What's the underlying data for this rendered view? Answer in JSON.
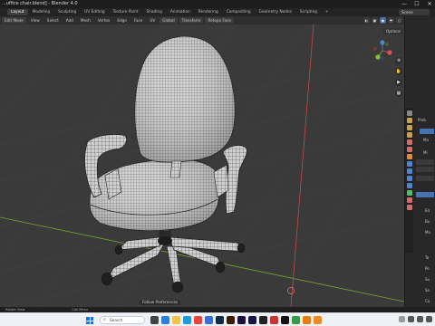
{
  "window": {
    "title": "...uffice chair.blend] - Blender 4.0",
    "minimize": "—",
    "maximize": "☐",
    "close": "✕"
  },
  "workspace_tabs": [
    "Layout",
    "Modeling",
    "Sculpting",
    "UV Editing",
    "Texture Paint",
    "Shading",
    "Animation",
    "Rendering",
    "Compositing",
    "Geometry Nodes",
    "Scripting",
    "+"
  ],
  "scene": {
    "label": "Scene"
  },
  "viewport_header": {
    "mode": "Edit Mode",
    "menus": [
      "View",
      "Select",
      "Add",
      "Mesh",
      "Vertex",
      "Edge",
      "Face",
      "UV"
    ],
    "orientation": "Global",
    "pivot": "Transform",
    "snapping": "Retopo Face",
    "options": "Options"
  },
  "viewport": {
    "footer_label": "Follow Preferences"
  },
  "properties": {
    "item1": "Prob",
    "item2": "Ma",
    "item3": "Mi",
    "row_labels": [
      "Ed",
      "Bu",
      "Mo",
      "Te",
      "Po",
      "Su",
      "Sa",
      "Ca"
    ]
  },
  "statusbar": {
    "item1": "Rotate View",
    "item2": "Call Menu"
  },
  "taskbar": {
    "search_placeholder": "Search"
  },
  "colors": {
    "grid_red": "#c64a4a",
    "grid_green": "#7aa233",
    "accent_blue": "#4772b3",
    "mesh_fill": "#d9d9d9"
  }
}
